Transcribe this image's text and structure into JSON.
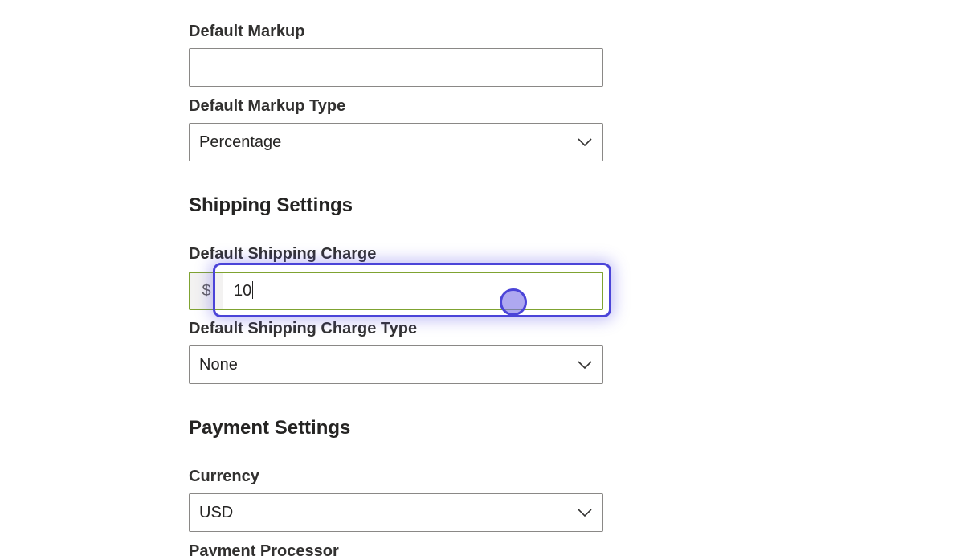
{
  "pricing": {
    "default_markup_label": "Default Markup",
    "default_markup_value": "",
    "default_markup_type_label": "Default Markup Type",
    "default_markup_type_value": "Percentage"
  },
  "shipping": {
    "heading": "Shipping Settings",
    "default_charge_label": "Default Shipping Charge",
    "currency_prefix": "$",
    "default_charge_value": "10",
    "default_charge_type_label": "Default Shipping Charge Type",
    "default_charge_type_value": "None"
  },
  "payment": {
    "heading": "Payment Settings",
    "currency_label": "Currency",
    "currency_value": "USD",
    "processor_label": "Payment Processor"
  },
  "icons": {
    "dropdown": "chevron-down-icon"
  },
  "colors": {
    "active_field_border": "#7fa331",
    "focus_highlight": "#4b44d8"
  }
}
